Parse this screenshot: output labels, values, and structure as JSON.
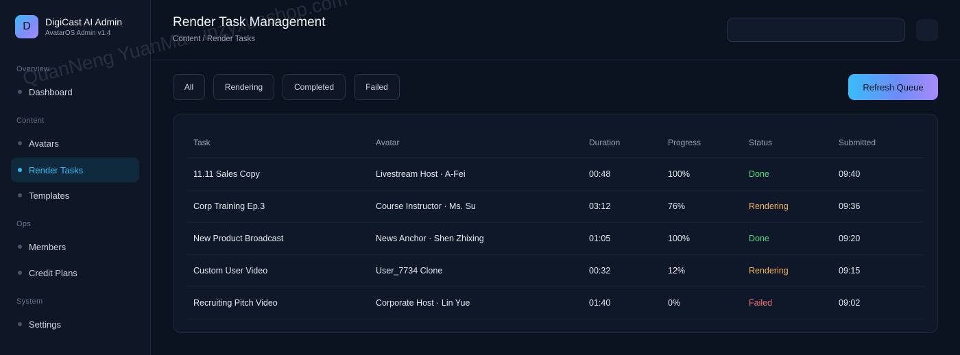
{
  "brand": {
    "logo_letter": "D",
    "title": "DigiCast AI Admin",
    "subtitle": "AvatarOS Admin v1.4"
  },
  "sidebar": {
    "sections": [
      {
        "label": "Overview",
        "items": [
          {
            "label": "Dashboard",
            "active": false
          }
        ]
      },
      {
        "label": "Content",
        "items": [
          {
            "label": "Avatars",
            "active": false
          },
          {
            "label": "Render Tasks",
            "active": true
          },
          {
            "label": "Templates",
            "active": false
          }
        ]
      },
      {
        "label": "Ops",
        "items": [
          {
            "label": "Members",
            "active": false
          },
          {
            "label": "Credit Plans",
            "active": false
          }
        ]
      },
      {
        "label": "System",
        "items": [
          {
            "label": "Settings",
            "active": false
          }
        ]
      }
    ]
  },
  "header": {
    "title": "Render Task Management",
    "breadcrumb": "Content / Render Tasks",
    "search_value": ""
  },
  "filters": [
    "All",
    "Rendering",
    "Completed",
    "Failed"
  ],
  "actions": {
    "refresh_label": "Refresh Queue"
  },
  "table": {
    "columns": [
      "Task",
      "Avatar",
      "Duration",
      "Progress",
      "Status",
      "Submitted"
    ],
    "rows": [
      {
        "task": "11.11 Sales Copy",
        "avatar": "Livestream Host · A-Fei",
        "duration": "00:48",
        "progress": "100%",
        "status": "Done",
        "submitted": "09:40"
      },
      {
        "task": "Corp Training Ep.3",
        "avatar": "Course Instructor · Ms. Su",
        "duration": "03:12",
        "progress": "76%",
        "status": "Rendering",
        "submitted": "09:36"
      },
      {
        "task": "New Product Broadcast",
        "avatar": "News Anchor · Shen Zhixing",
        "duration": "01:05",
        "progress": "100%",
        "status": "Done",
        "submitted": "09:20"
      },
      {
        "task": "Custom User Video",
        "avatar": "User_7734 Clone",
        "duration": "00:32",
        "progress": "12%",
        "status": "Rendering",
        "submitted": "09:15"
      },
      {
        "task": "Recruiting Pitch Video",
        "avatar": "Corporate Host · Lin Yue",
        "duration": "01:40",
        "progress": "0%",
        "status": "Failed",
        "submitted": "09:02"
      }
    ]
  },
  "status_colors": {
    "Done": "#4ade80",
    "Rendering": "#f0b45a",
    "Failed": "#f87171"
  },
  "accent_color": "#38bdf8",
  "watermark": "QuanNeng YuanMa · inzyxuashop.com"
}
